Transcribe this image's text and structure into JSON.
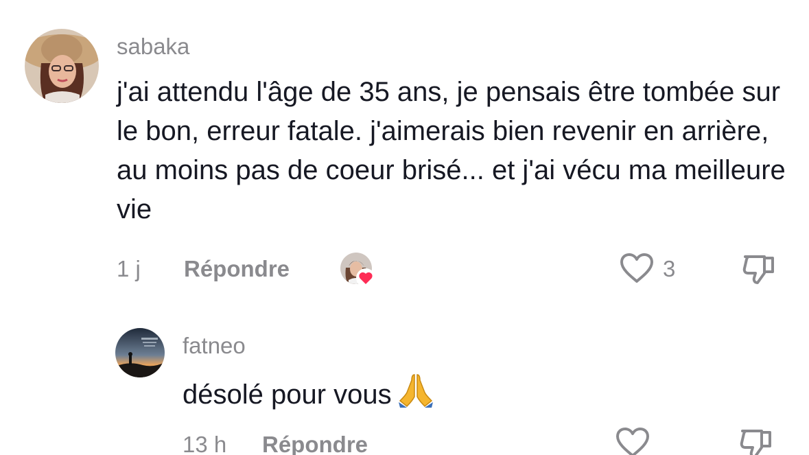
{
  "comments": [
    {
      "username": "sabaka",
      "text": "j'ai attendu l'âge de 35 ans, je pensais être tombée sur le bon, erreur fatale. j'aimerais bien revenir en arrière, au moins pas de coeur brisé... et j'ai vécu ma meilleure vie",
      "time": "1 j",
      "reply_label": "Répondre",
      "like_count": "3",
      "liked_by_creator": true,
      "avatar": "woman-in-hat-avatar"
    }
  ],
  "replies": [
    {
      "username": "fatneo",
      "text": "désolé pour vous",
      "emoji": "folded-hands-emoji",
      "time": "13 h",
      "reply_label": "Répondre",
      "avatar": "silhouette-landscape-avatar"
    }
  ],
  "icons": {
    "like": "heart-outline-icon",
    "dislike": "thumbs-down-outline-icon",
    "creator_badge": "red-heart-icon"
  },
  "colors": {
    "text_primary": "#161823",
    "text_secondary": "#8a8a8e",
    "heart_badge": "#fe2c55",
    "emoji": "#f5b52e"
  }
}
